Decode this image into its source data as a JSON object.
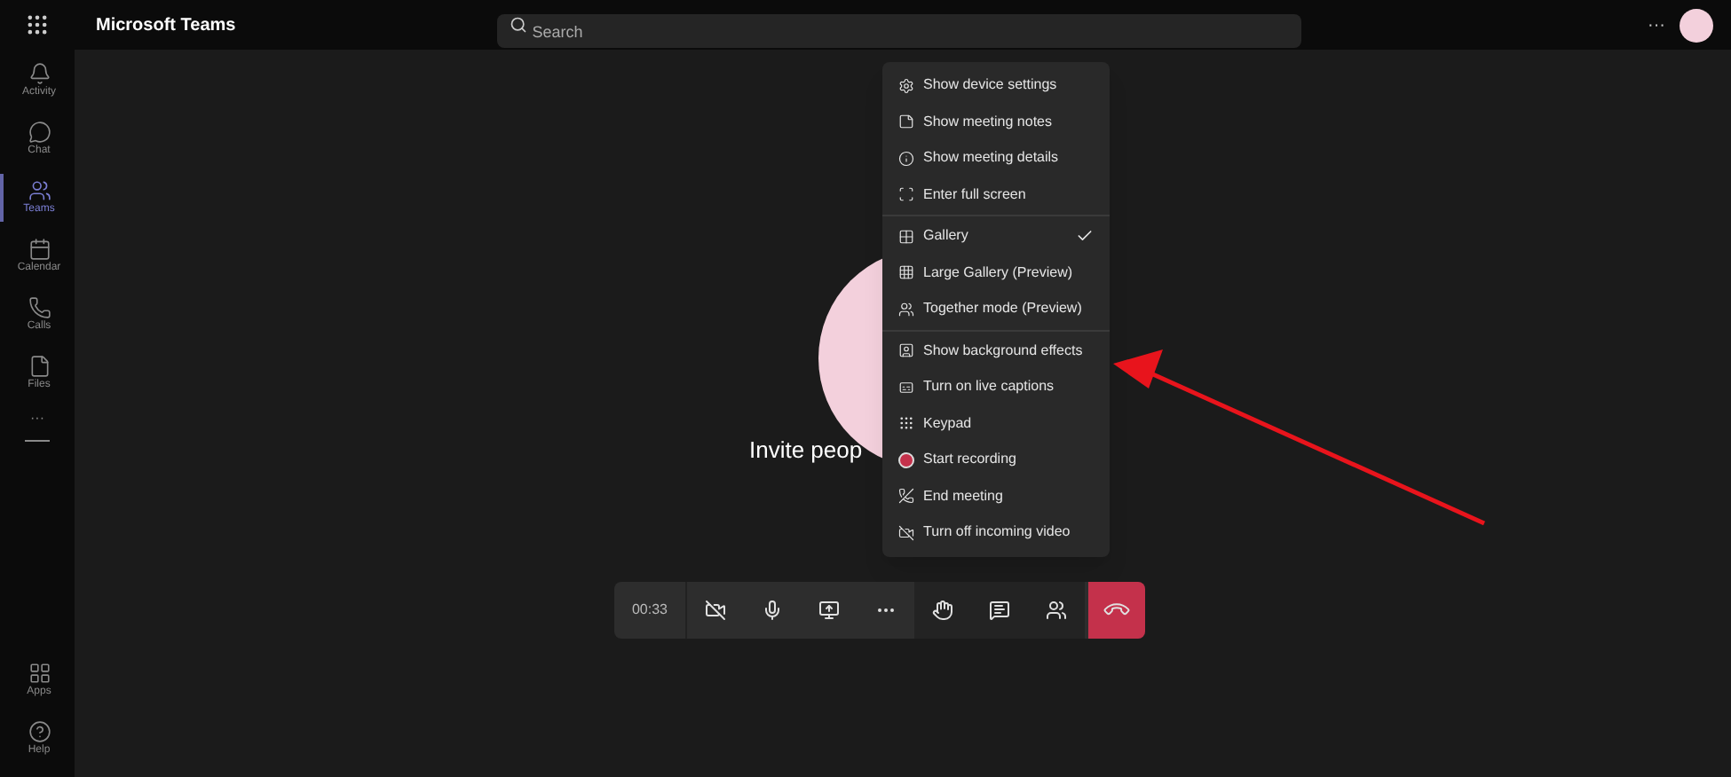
{
  "app": {
    "title": "Microsoft Teams"
  },
  "search": {
    "placeholder": "Search"
  },
  "rail": {
    "items": [
      {
        "kind": "activity",
        "label": "Activity",
        "selected": false
      },
      {
        "kind": "chat",
        "label": "Chat",
        "selected": false
      },
      {
        "kind": "teams",
        "label": "Teams",
        "selected": true
      },
      {
        "kind": "calendar",
        "label": "Calendar",
        "selected": false
      },
      {
        "kind": "calls",
        "label": "Calls",
        "selected": false
      },
      {
        "kind": "files",
        "label": "Files",
        "selected": false
      }
    ],
    "more": "···",
    "bottom_items": [
      {
        "kind": "apps",
        "label": "Apps"
      },
      {
        "kind": "help",
        "label": "Help"
      }
    ]
  },
  "header": {
    "more": "···"
  },
  "stage": {
    "invite_text": "Invite peop"
  },
  "menu": {
    "sections": [
      [
        {
          "kind": "settings",
          "label": "Show device settings",
          "checked": false
        },
        {
          "kind": "notes",
          "label": "Show meeting notes",
          "checked": false
        },
        {
          "kind": "info",
          "label": "Show meeting details",
          "checked": false
        },
        {
          "kind": "fullscreen",
          "label": "Enter full screen",
          "checked": false
        }
      ],
      [
        {
          "kind": "gallery",
          "label": "Gallery",
          "checked": true
        },
        {
          "kind": "large-gallery",
          "label": "Large Gallery (Preview)",
          "checked": false
        },
        {
          "kind": "together",
          "label": "Together mode (Preview)",
          "checked": false
        }
      ],
      [
        {
          "kind": "background",
          "label": "Show background effects",
          "checked": false
        },
        {
          "kind": "captions",
          "label": "Turn on live captions",
          "checked": false
        },
        {
          "kind": "keypad",
          "label": "Keypad",
          "checked": false
        },
        {
          "kind": "record",
          "label": "Start recording",
          "checked": false
        },
        {
          "kind": "end",
          "label": "End meeting",
          "checked": false
        },
        {
          "kind": "video-off",
          "label": "Turn off incoming video",
          "checked": false
        }
      ]
    ]
  },
  "call_bar": {
    "timer": "00:33",
    "controls": [
      {
        "kind": "camera-off"
      },
      {
        "kind": "mic"
      },
      {
        "kind": "share"
      },
      {
        "kind": "more"
      },
      {
        "kind": "hand"
      },
      {
        "kind": "chat"
      },
      {
        "kind": "people"
      },
      {
        "kind": "hangup"
      }
    ]
  }
}
